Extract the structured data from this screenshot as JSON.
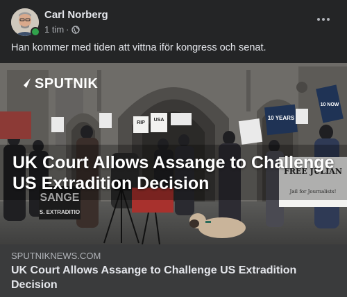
{
  "post": {
    "author": "Carl Norberg",
    "time": "1 tim",
    "separator": "·",
    "privacy_icon": "globe-icon",
    "more_icon": "more-options-icon",
    "text": "Han kommer med tiden att vittna iför kongress och senat."
  },
  "media": {
    "logo_text": "SPUTNIK",
    "headline": "UK Court Allows Assange to Challenge US Extradition Decision",
    "signs": {
      "rip": "RIP",
      "usa": "USA",
      "ten_years": "10 YEARS",
      "free_julian": "FREE JULIAN",
      "free_julian_sub": "Jail for Journalists!",
      "sange": "SANGE",
      "extradition": "S. EXTRADITIO",
      "now": "10 NOW"
    }
  },
  "link": {
    "domain": "SPUTNIKNEWS.COM",
    "title": "UK Court Allows Assange to Challenge US Extradition Decision"
  },
  "colors": {
    "background": "#242526",
    "link_box": "#3a3b3c",
    "primary_text": "#e4e6eb",
    "secondary_text": "#b0b3b8",
    "online": "#31a24c"
  }
}
